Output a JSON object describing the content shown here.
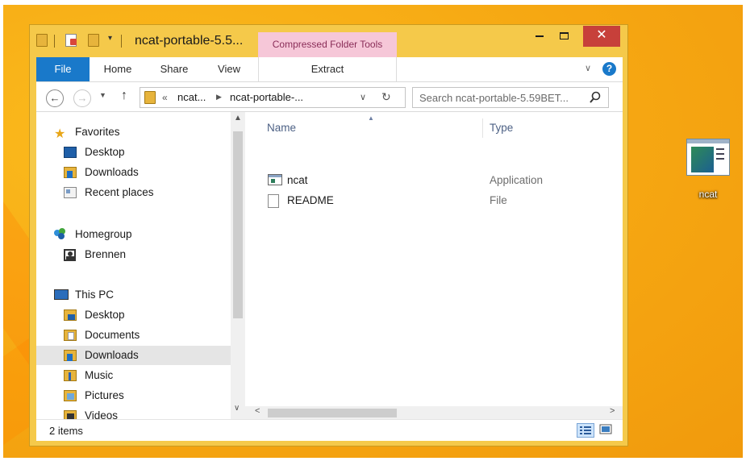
{
  "window": {
    "title": "ncat-portable-5.5...",
    "context_tab": "Compressed Folder Tools",
    "close_glyph": "✕"
  },
  "ribbon": {
    "tabs": [
      "File",
      "Home",
      "Share",
      "View",
      "Extract"
    ]
  },
  "address_bar": {
    "overflow": "«",
    "crumbs": [
      "ncat...",
      "ncat-portable-..."
    ]
  },
  "search": {
    "placeholder": "Search ncat-portable-5.59BET..."
  },
  "nav_pane": {
    "groups": [
      {
        "label": "Favorites",
        "icon": "star-icon",
        "items": [
          {
            "label": "Desktop",
            "icon": "desktop-icon"
          },
          {
            "label": "Downloads",
            "icon": "downloads-folder-icon"
          },
          {
            "label": "Recent places",
            "icon": "recent-places-icon"
          }
        ]
      },
      {
        "label": "Homegroup",
        "icon": "homegroup-icon",
        "items": [
          {
            "label": "Brennen",
            "icon": "user-icon"
          }
        ]
      },
      {
        "label": "This PC",
        "icon": "computer-icon",
        "items": [
          {
            "label": "Desktop",
            "icon": "desktop-folder-icon"
          },
          {
            "label": "Documents",
            "icon": "documents-folder-icon"
          },
          {
            "label": "Downloads",
            "icon": "downloads-folder-icon",
            "selected": true
          },
          {
            "label": "Music",
            "icon": "music-folder-icon"
          },
          {
            "label": "Pictures",
            "icon": "pictures-folder-icon"
          },
          {
            "label": "Videos",
            "icon": "videos-folder-icon"
          }
        ]
      }
    ]
  },
  "file_list": {
    "columns": [
      "Name",
      "Type"
    ],
    "rows": [
      {
        "name": "ncat",
        "type": "Application",
        "icon": "application-icon"
      },
      {
        "name": "README",
        "type": "File",
        "icon": "file-icon"
      }
    ]
  },
  "status": {
    "item_count": "2 items"
  },
  "desktop": {
    "icon_label": "ncat"
  },
  "colors": {
    "accent": "#1979ca",
    "desktop_bg": "#f6a712",
    "context_tab_bg": "#f6c7d8",
    "close_button": "#c7403a"
  }
}
